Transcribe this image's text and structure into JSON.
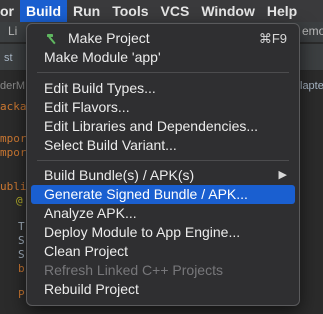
{
  "menubar": {
    "items": [
      "or",
      "Build",
      "Run",
      "Tools",
      "VCS",
      "Window",
      "Help"
    ],
    "active_index": 1
  },
  "background": {
    "tab_left": "Li",
    "tab_right": "emo",
    "row2_left": "st",
    "row2_right": "lapte",
    "side_label": "derM",
    "code": [
      "acka",
      "mpor",
      "mpor",
      "ubli",
      "@",
      "T",
      "S",
      "S",
      "b",
      "P"
    ]
  },
  "build_menu": {
    "make_project": "Make Project",
    "make_project_shortcut": "⌘F9",
    "make_module": "Make Module 'app'",
    "edit_build_types": "Edit Build Types...",
    "edit_flavors": "Edit Flavors...",
    "edit_libraries": "Edit Libraries and Dependencies...",
    "select_build_variant": "Select Build Variant...",
    "build_bundles": "Build Bundle(s) / APK(s)",
    "generate_signed": "Generate Signed Bundle / APK...",
    "analyze_apk": "Analyze APK...",
    "deploy_module": "Deploy Module to App Engine...",
    "clean_project": "Clean Project",
    "refresh_linked": "Refresh Linked C++ Projects",
    "rebuild_project": "Rebuild Project"
  },
  "colors": {
    "accent": "#1a5fd0",
    "hammer": "#5fb760",
    "disabled": "#77777a"
  },
  "icons": {
    "make_project": "hammer-icon",
    "submenu": "chevron-right-icon"
  }
}
